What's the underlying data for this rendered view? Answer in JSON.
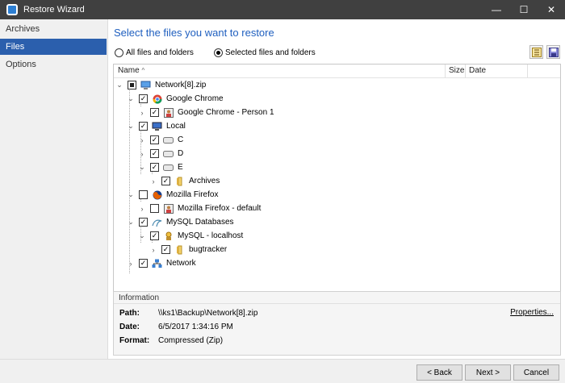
{
  "window": {
    "title": "Restore Wizard",
    "min": "—",
    "max": "☐",
    "close": "✕"
  },
  "sidebar": {
    "items": [
      {
        "label": "Archives"
      },
      {
        "label": "Files"
      },
      {
        "label": "Options"
      }
    ]
  },
  "main": {
    "heading": "Select the files you want to restore",
    "radio_all": "All files and folders",
    "radio_selected": "Selected files and folders"
  },
  "tree": {
    "columns": {
      "name": "Name",
      "size": "Size",
      "date": "Date"
    },
    "rows": [
      {
        "label": "Network[8].zip"
      },
      {
        "label": "Google Chrome"
      },
      {
        "label": "Google Chrome - Person 1"
      },
      {
        "label": "Local"
      },
      {
        "label": "C"
      },
      {
        "label": "D"
      },
      {
        "label": "E"
      },
      {
        "label": "Archives"
      },
      {
        "label": "Mozilla Firefox"
      },
      {
        "label": "Mozilla Firefox - default"
      },
      {
        "label": "MySQL Databases"
      },
      {
        "label": "MySQL - localhost"
      },
      {
        "label": "bugtracker"
      },
      {
        "label": "Network"
      }
    ]
  },
  "info": {
    "title": "Information",
    "path_label": "Path:",
    "path_value": "\\\\ks1\\Backup\\Network[8].zip",
    "date_label": "Date:",
    "date_value": "6/5/2017 1:34:16 PM",
    "format_label": "Format:",
    "format_value": "Compressed (Zip)",
    "properties": "Properties..."
  },
  "footer": {
    "back": "< Back",
    "next": "Next >",
    "cancel": "Cancel"
  },
  "colors": {
    "accent": "#2b5fad",
    "heading": "#1f5fbf",
    "titlebar": "#404040"
  }
}
